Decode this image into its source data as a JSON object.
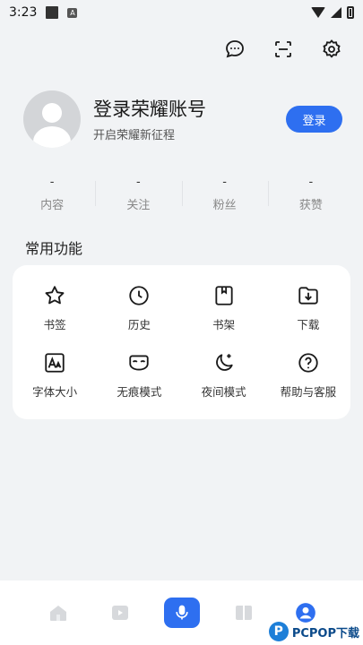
{
  "status_bar": {
    "time": "3:23"
  },
  "header": {
    "icons": [
      "chat-bubble-icon",
      "scan-icon",
      "settings-gear-icon"
    ]
  },
  "profile": {
    "title": "登录荣耀账号",
    "subtitle": "开启荣耀新征程",
    "login_label": "登录"
  },
  "stats": [
    {
      "value": "-",
      "label": "内容"
    },
    {
      "value": "-",
      "label": "关注"
    },
    {
      "value": "-",
      "label": "粉丝"
    },
    {
      "value": "-",
      "label": "获赞"
    }
  ],
  "functions_title": "常用功能",
  "functions": [
    {
      "label": "书签",
      "icon": "star-icon"
    },
    {
      "label": "历史",
      "icon": "clock-icon"
    },
    {
      "label": "书架",
      "icon": "bookshelf-icon"
    },
    {
      "label": "下载",
      "icon": "download-folder-icon"
    },
    {
      "label": "字体大小",
      "icon": "font-size-icon"
    },
    {
      "label": "无痕模式",
      "icon": "incognito-mask-icon"
    },
    {
      "label": "夜间模式",
      "icon": "moon-icon"
    },
    {
      "label": "帮助与客服",
      "icon": "help-icon"
    }
  ],
  "bottom_nav": {
    "items": [
      "home-icon",
      "video-icon",
      "microphone-icon",
      "novel-icon",
      "profile-icon"
    ],
    "accent_color": "#2e6ff0"
  },
  "watermark": {
    "text": "PCPOP下载"
  }
}
